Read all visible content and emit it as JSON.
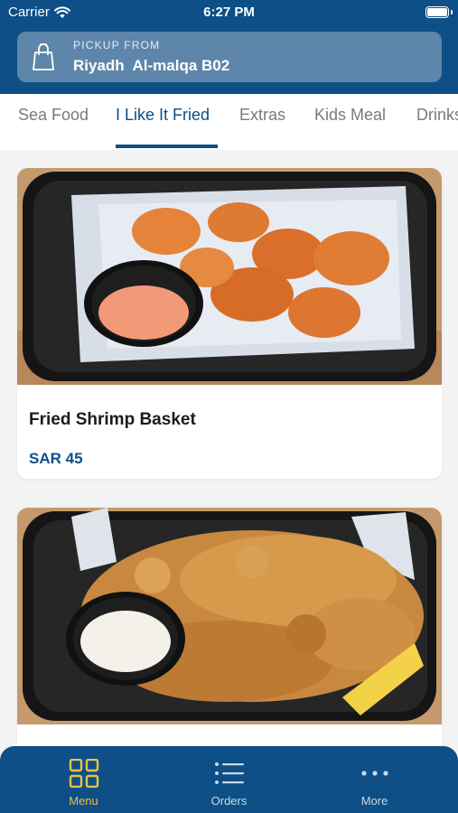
{
  "status_bar": {
    "carrier": "Carrier",
    "time": "6:27 PM"
  },
  "pickup": {
    "caption": "PICKUP FROM",
    "location": "Riyadh  Al-malqa B02",
    "icon": "shopping-bag-icon"
  },
  "tabs": [
    {
      "label": "Sea Food"
    },
    {
      "label": "I Like It Fried",
      "active": true
    },
    {
      "label": "Extras"
    },
    {
      "label": "Kids Meal"
    },
    {
      "label": "Drinks"
    }
  ],
  "products": [
    {
      "name": "Fried Shrimp Basket",
      "price": "SAR 45"
    },
    {
      "name": "",
      "price": ""
    }
  ],
  "bottom_nav": [
    {
      "label": "Menu",
      "icon": "grid-icon",
      "active": true
    },
    {
      "label": "Orders",
      "icon": "list-icon"
    },
    {
      "label": "More",
      "icon": "more-dots-icon"
    }
  ],
  "colors": {
    "brand": "#0d4f86",
    "pickup_card": "#5e86aa",
    "active_nav": "#e9c23f"
  }
}
